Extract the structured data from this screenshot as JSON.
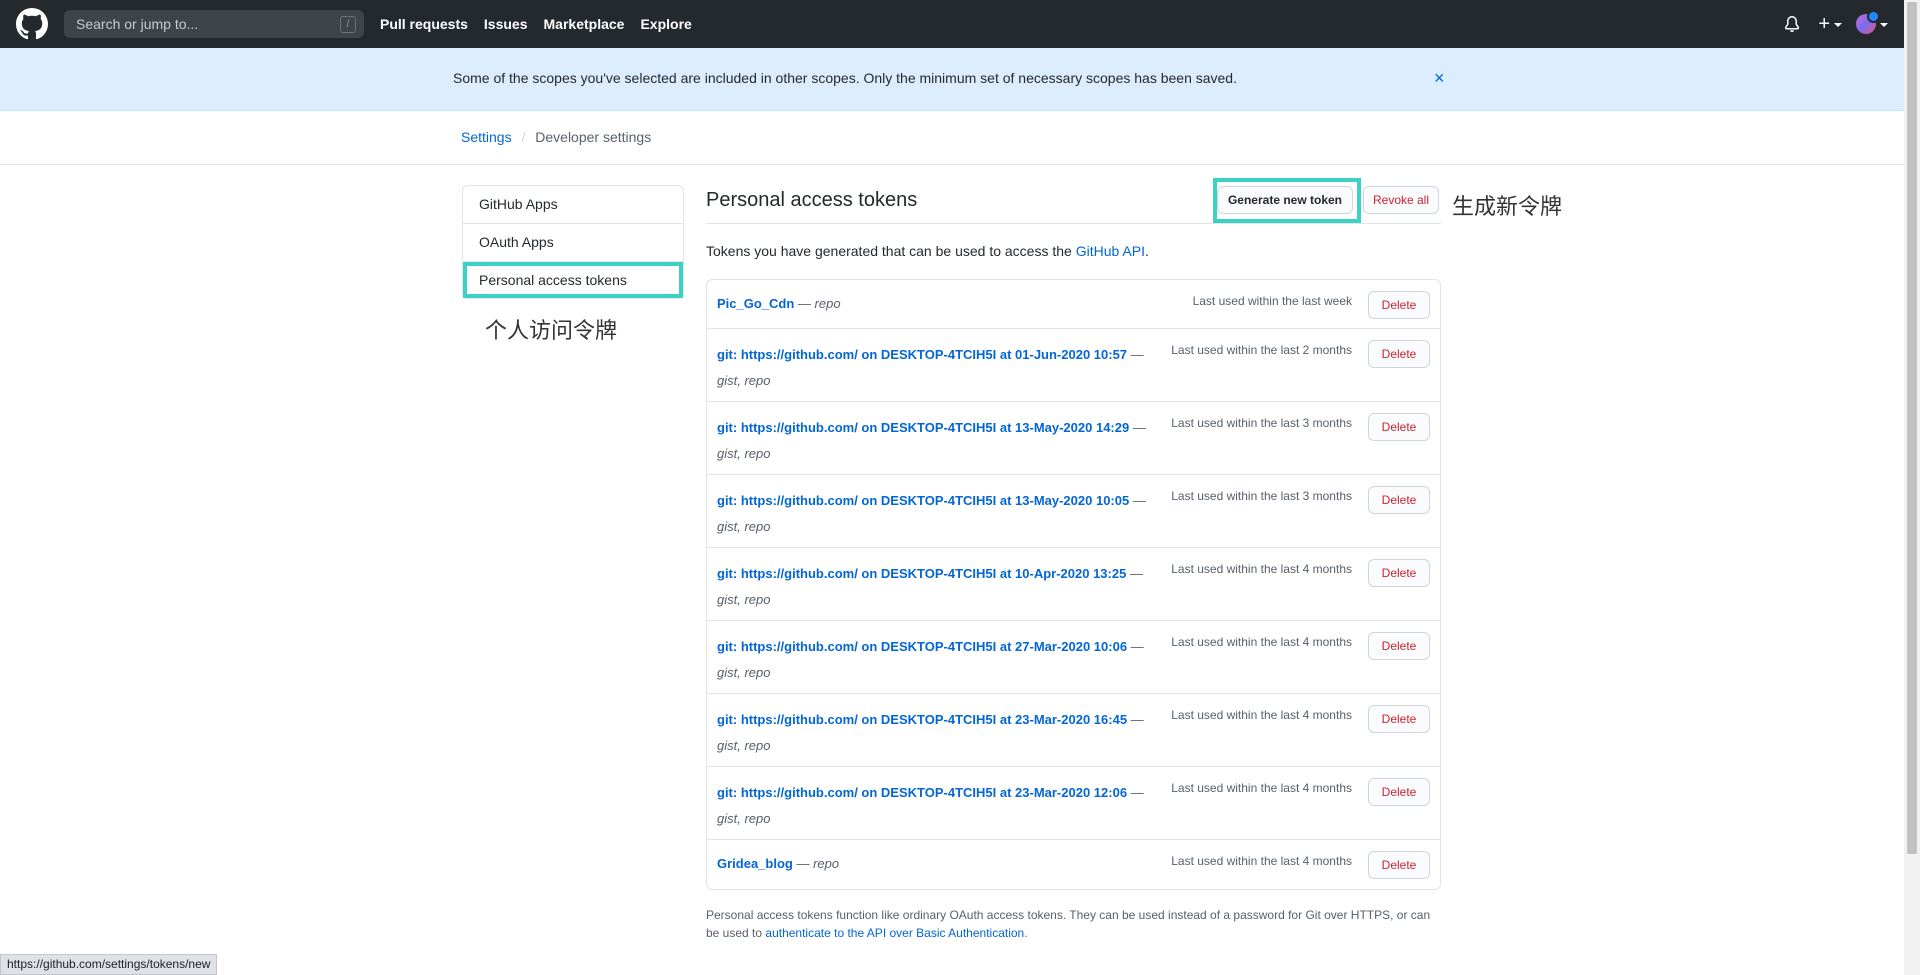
{
  "header": {
    "search_placeholder": "Search or jump to...",
    "search_shortcut": "/",
    "nav": [
      "Pull requests",
      "Issues",
      "Marketplace",
      "Explore"
    ],
    "plus_label": "+"
  },
  "flash": {
    "message": "Some of the scopes you've selected are included in other scopes. Only the minimum set of necessary scopes has been saved.",
    "close": "×"
  },
  "breadcrumb": {
    "settings": "Settings",
    "separator": "/",
    "current": "Developer settings"
  },
  "sidebar": {
    "items": [
      {
        "label": "GitHub Apps"
      },
      {
        "label": "OAuth Apps"
      },
      {
        "label": "Personal access tokens"
      }
    ]
  },
  "annotations": {
    "left": "个人访问令牌",
    "right": "生成新令牌"
  },
  "main": {
    "title": "Personal access tokens",
    "generate_button": "Generate new token",
    "revoke_button": "Revoke all",
    "intro_prefix": "Tokens you have generated that can be used to access the ",
    "intro_link": "GitHub API",
    "intro_suffix": ".",
    "delete_label": "Delete",
    "tokens": [
      {
        "name": "Pic_Go_Cdn",
        "scopes": "repo",
        "last_used": "Last used within the last week"
      },
      {
        "name": "git: https://github.com/ on DESKTOP-4TCIH5I at 01-Jun-2020 10:57",
        "scopes": "gist, repo",
        "last_used": "Last used within the last 2 months"
      },
      {
        "name": "git: https://github.com/ on DESKTOP-4TCIH5I at 13-May-2020 14:29",
        "scopes": "gist, repo",
        "last_used": "Last used within the last 3 months"
      },
      {
        "name": "git: https://github.com/ on DESKTOP-4TCIH5I at 13-May-2020 10:05",
        "scopes": "gist, repo",
        "last_used": "Last used within the last 3 months"
      },
      {
        "name": "git: https://github.com/ on DESKTOP-4TCIH5I at 10-Apr-2020 13:25",
        "scopes": "gist, repo",
        "last_used": "Last used within the last 4 months"
      },
      {
        "name": "git: https://github.com/ on DESKTOP-4TCIH5I at 27-Mar-2020 10:06",
        "scopes": "gist, repo",
        "last_used": "Last used within the last 4 months"
      },
      {
        "name": "git: https://github.com/ on DESKTOP-4TCIH5I at 23-Mar-2020 16:45",
        "scopes": "gist, repo",
        "last_used": "Last used within the last 4 months"
      },
      {
        "name": "git: https://github.com/ on DESKTOP-4TCIH5I at 23-Mar-2020 12:06",
        "scopes": "gist, repo",
        "last_used": "Last used within the last 4 months"
      },
      {
        "name": "Gridea_blog",
        "scopes": "repo",
        "last_used": "Last used within the last 4 months"
      }
    ],
    "footnote_text": "Personal access tokens function like ordinary OAuth access tokens. They can be used instead of a password for Git over HTTPS, or can be used to ",
    "footnote_link": "authenticate to the API over Basic Authentication",
    "footnote_suffix": "."
  },
  "status_bar": {
    "url": "https://github.com/settings/tokens/new"
  },
  "colors": {
    "header_bg": "#24292e",
    "flash_bg": "#dbedff",
    "link": "#0366d6",
    "danger": "#cb2431",
    "highlight": "#3bd1c4"
  }
}
